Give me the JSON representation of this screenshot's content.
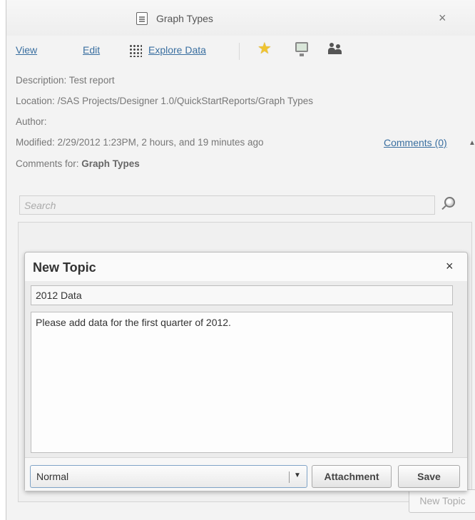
{
  "window": {
    "title": "Graph Types",
    "title_icon": "report-document-icon",
    "close_glyph": "×"
  },
  "toolbar": {
    "view_label": "View",
    "edit_label": "Edit",
    "explore_label": "Explore Data",
    "icons": [
      "data-grid-icon",
      "favorite-star-icon",
      "presentation-monitor-icon",
      "users-icon"
    ]
  },
  "details": {
    "description_label": "Description:",
    "description_value": "Test report",
    "location_label": "Location:",
    "location_value": "/SAS Projects/Designer 1.0/QuickStartReports/Graph Types",
    "author_label": "Author:",
    "author_value": "",
    "modified_label": "Modified:",
    "modified_value": "2/29/2012 1:23PM, 2 hours, and 19 minutes ago",
    "comments_link": "Comments (0)",
    "comments_for_label": "Comments for:",
    "comments_for_value": "Graph Types"
  },
  "search": {
    "placeholder": "Search"
  },
  "new_topic_button": "New Topic",
  "dialog": {
    "title": "New Topic",
    "close_glyph": "×",
    "subject_value": "2012 Data",
    "message_value": "Please add data for the first quarter of 2012.",
    "priority": {
      "selected": "Normal"
    },
    "attachment_label": "Attachment",
    "save_label": "Save"
  },
  "colors": {
    "link": "#3a6fa0",
    "star": "#f0c430",
    "select_border": "#7fa3c6"
  }
}
